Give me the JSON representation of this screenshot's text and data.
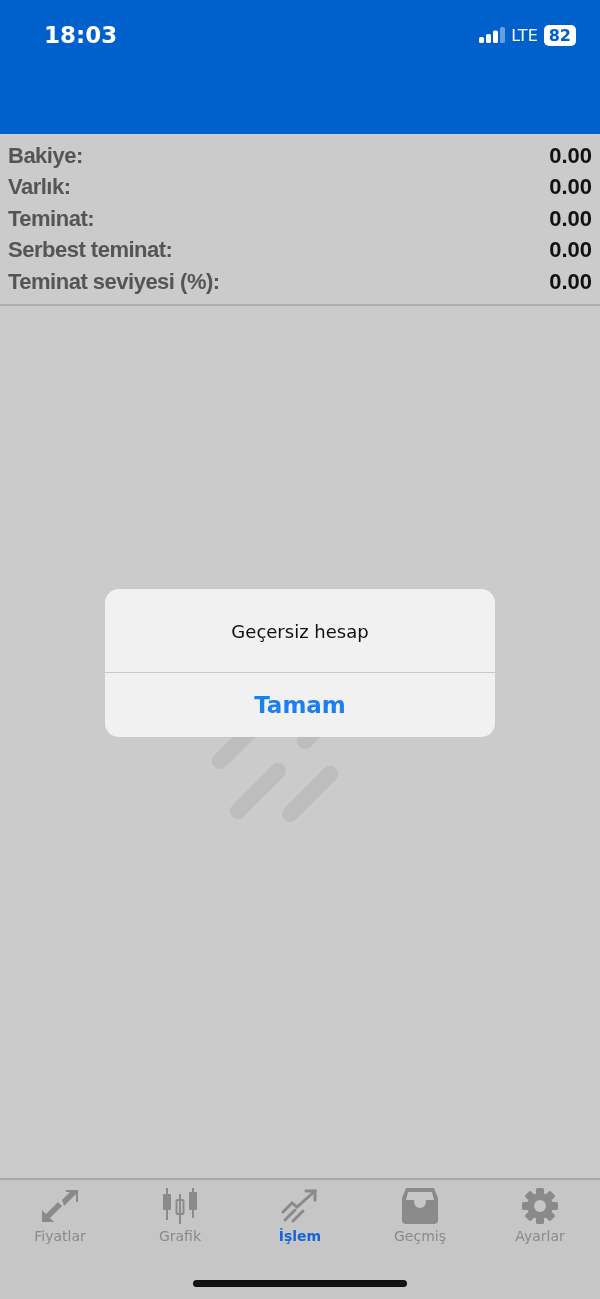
{
  "status_bar": {
    "time": "18:03",
    "network": "LTE",
    "battery": "82"
  },
  "account_summary": [
    {
      "label": "Bakiye:",
      "value": "0.00"
    },
    {
      "label": "Varlık:",
      "value": "0.00"
    },
    {
      "label": "Teminat:",
      "value": "0.00"
    },
    {
      "label": "Serbest teminat:",
      "value": "0.00"
    },
    {
      "label": "Teminat seviyesi (%):",
      "value": "0.00"
    }
  ],
  "alert": {
    "message": "Geçersiz hesap",
    "button": "Tamam"
  },
  "tabs": [
    {
      "label": "Fiyatlar",
      "selected": false
    },
    {
      "label": "Grafik",
      "selected": false
    },
    {
      "label": "İşlem",
      "selected": true
    },
    {
      "label": "Geçmiş",
      "selected": false
    },
    {
      "label": "Ayarlar",
      "selected": false
    }
  ]
}
